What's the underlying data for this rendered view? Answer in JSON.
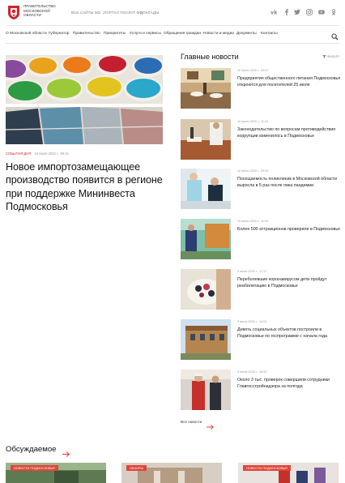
{
  "header": {
    "logo_text": "ПРАВИТЕЛЬСТВО МОСКОВСКОЙ ОБЛАСТИ",
    "top_links": [
      "ВСЕ САЙТЫ МО",
      "ПОРТАЛ ПОСЛУГ МО",
      "ДОКЛАДЫ"
    ],
    "social_icons": [
      "vk-icon",
      "facebook-icon",
      "twitter-icon",
      "instagram-icon",
      "youtube-icon",
      "odnoklassniki-icon"
    ]
  },
  "nav": {
    "items": [
      "О Московской области",
      "Губернатор",
      "Правительство",
      "Приоритеты",
      "Услуги и сервисы",
      "Обращения граждан",
      "Новости и медиа",
      "Документы",
      "Контакты"
    ]
  },
  "featured": {
    "category": "СОБЫТИЯ ДНЯ",
    "date": "10 июля 2020 г., 09:41",
    "title": "Новое импортозамещающее производство появится в регионе при поддержке Мининвеста Подмосковья"
  },
  "main_news": {
    "heading": "Главные новости",
    "filter_label": "ФИЛЬТР",
    "items": [
      {
        "date": "10 июля 2020 г., 09:07",
        "title": "Предприятия общественного питания Подмосковья откроются для посетителей 25 июля"
      },
      {
        "date": "10 июля 2020 г., 11:04",
        "title": "Законодательство по вопросам противодействия коррупции изменилось в Подмосковье"
      },
      {
        "date": "10 июля 2020 г., 09:00",
        "title": "Посещаемость поликлиник в Московской области выросла в 5 раз после пика пандемии"
      },
      {
        "date": "10 июля 2020 г., 11:00",
        "title": "Более 500 аттракционов проверили в Подмосковье"
      },
      {
        "date": "9 июля 2020 г., 17:17",
        "title": "Переболевшие коронавирусом дети пройдут реабилитацию в Подмосковье"
      },
      {
        "date": "9 июля 2020 г., 14:02",
        "title": "Девять социальных объектов построили в Подмосковье по госпрограмме с начала года"
      },
      {
        "date": "9 июля 2020 г., 16:32",
        "title": "Около 3 тыс. проверок совершили сотрудники Главгосстройнадзора за полгода"
      }
    ],
    "all_news_label": "Все новости"
  },
  "discussed": {
    "heading": "Обсуждаемое",
    "cards": [
      {
        "badge": "НОВОСТИ ПОДМОСКОВЬЯ"
      },
      {
        "badge": "ОБЗОРЫ"
      },
      {
        "badge": "НОВОСТИ ПОДМОСКОВЬЯ"
      }
    ]
  },
  "colors": {
    "accent": "#e0453a",
    "category": "#d12c2c",
    "text": "#222222",
    "muted": "#999999"
  }
}
